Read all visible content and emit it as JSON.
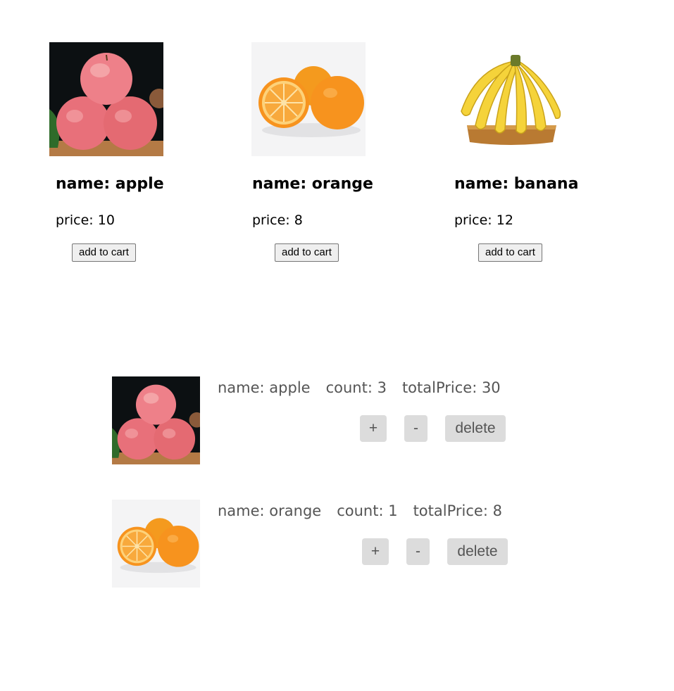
{
  "products": [
    {
      "name_text": "name: apple",
      "price_text": "price: 10",
      "button_label": "add to cart",
      "image": "apple-image"
    },
    {
      "name_text": "name: orange",
      "price_text": "price: 8",
      "button_label": "add to cart",
      "image": "orange-image"
    },
    {
      "name_text": "name: banana",
      "price_text": "price: 12",
      "button_label": "add to cart",
      "image": "banana-image"
    }
  ],
  "cart": {
    "items": [
      {
        "name_text": "name: apple",
        "count_text": "count: 3",
        "total_text": "totalPrice: 30",
        "plus_label": "+",
        "minus_label": "-",
        "delete_label": "delete",
        "image": "apple-image"
      },
      {
        "name_text": "name: orange",
        "count_text": "count: 1",
        "total_text": "totalPrice: 8",
        "plus_label": "+",
        "minus_label": "-",
        "delete_label": "delete",
        "image": "orange-image"
      }
    ]
  },
  "colors": {
    "cart_text": "#555555",
    "cart_button_bg": "#dcdcdc",
    "apple_red": "#e8707a",
    "orange": "#f7931e",
    "banana_yellow": "#f5d33a"
  }
}
